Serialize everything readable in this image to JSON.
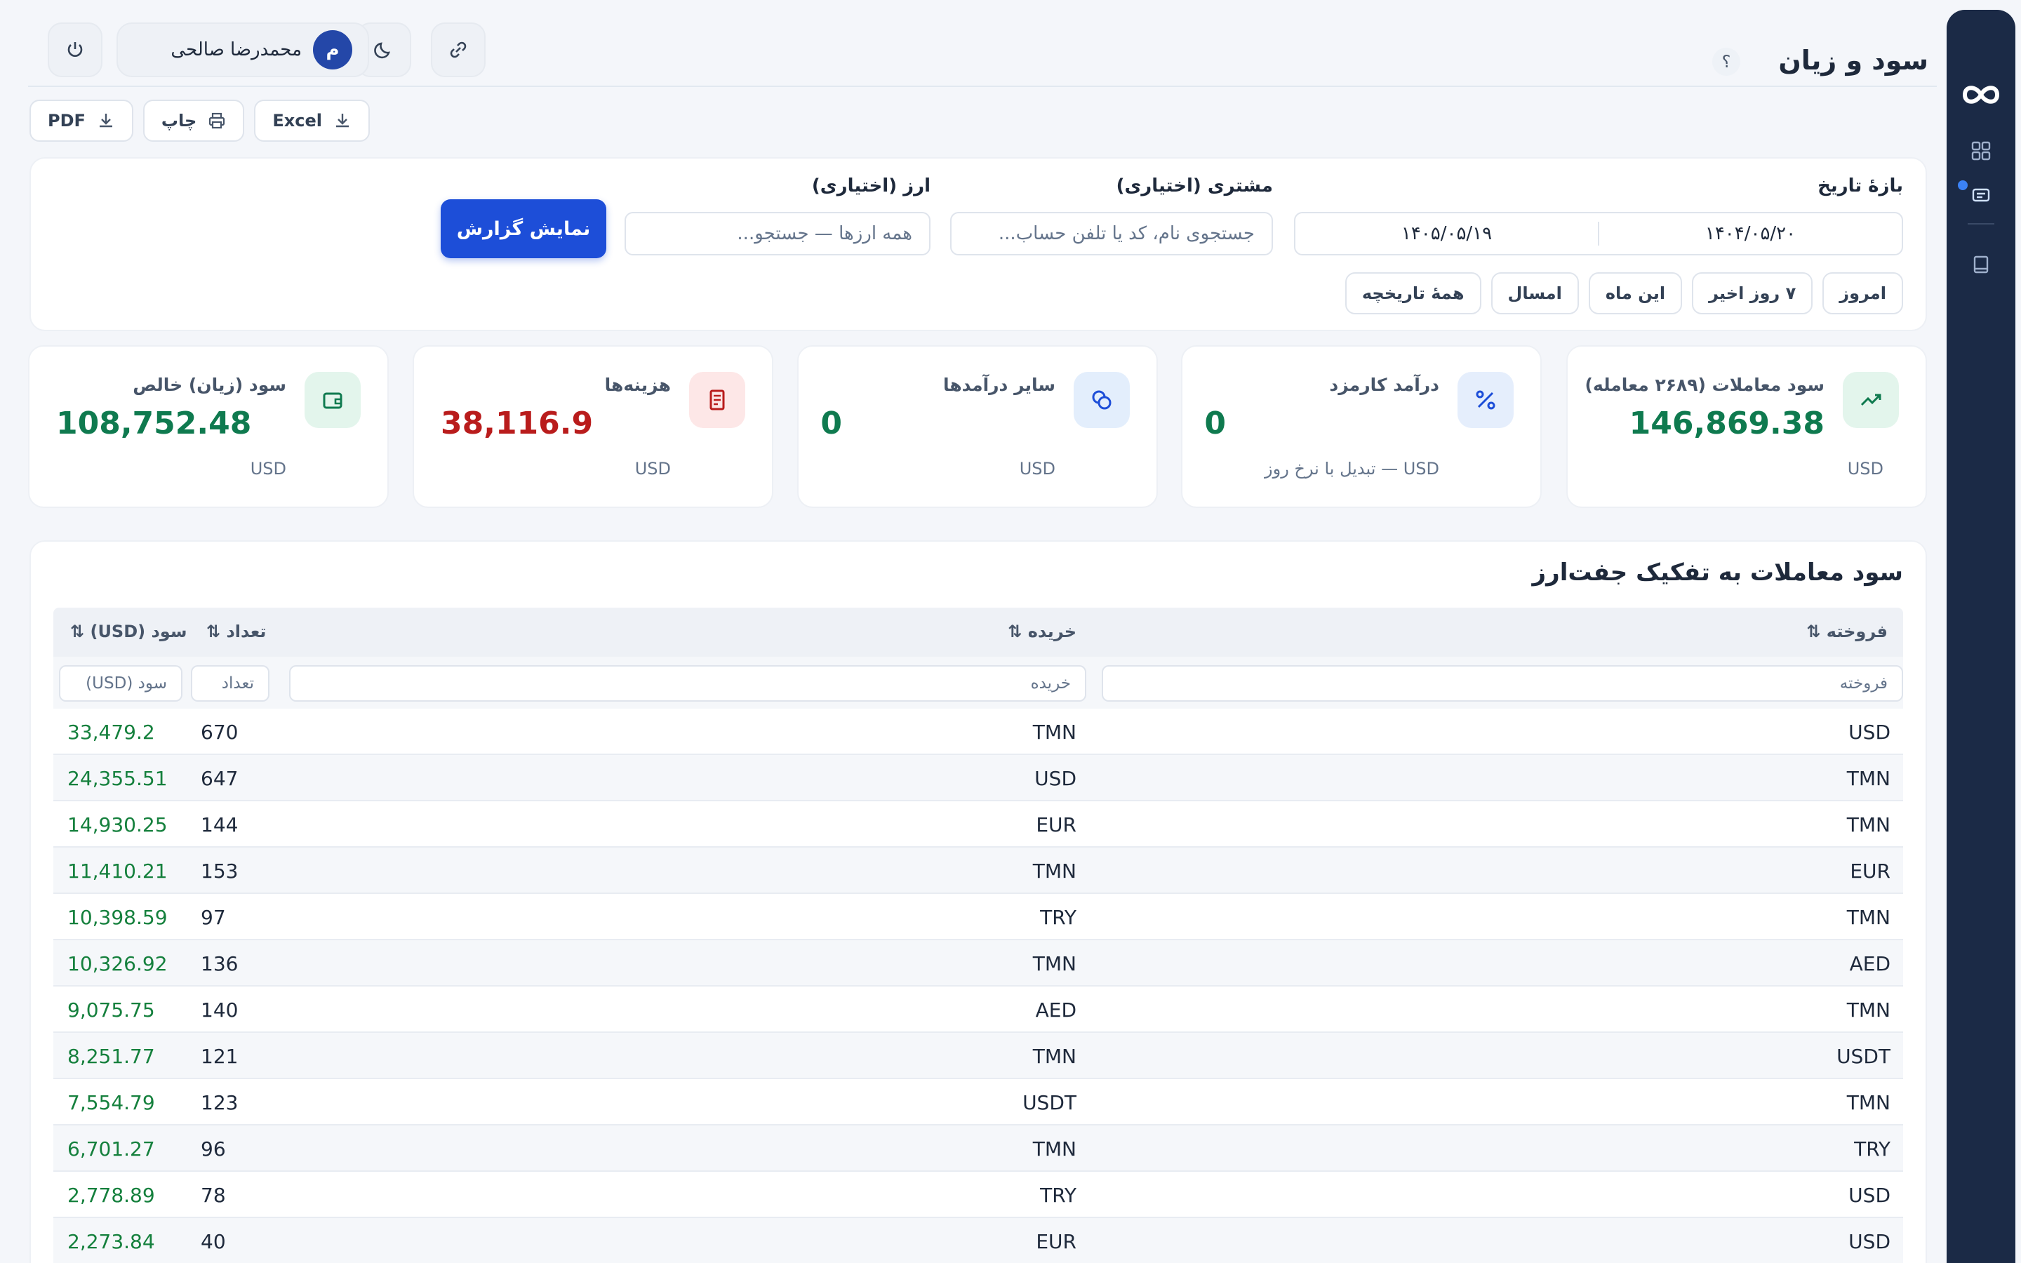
{
  "header": {
    "title": "سود و زیان",
    "help": "؟",
    "user_name": "محمدرضا صالحی",
    "user_initial": "م"
  },
  "export": {
    "excel": "Excel",
    "print": "چاپ",
    "pdf": "PDF"
  },
  "filters": {
    "date_label": "بازهٔ تاریخ",
    "date_from": "۱۴۰۴/۰۵/۲۰",
    "date_to": "۱۴۰۵/۰۵/۱۹",
    "customer_label": "مشتری (اختیاری)",
    "customer_placeholder": "جستجوی نام، کد یا تلفن حساب...",
    "currency_label": "ارز (اختیاری)",
    "currency_placeholder": "همه ارزها — جستجو...",
    "submit": "نمایش گزارش",
    "chips": [
      "امروز",
      "۷ روز اخیر",
      "این ماه",
      "امسال",
      "همهٔ تاریخچه"
    ]
  },
  "stats": [
    {
      "label": "سود معاملات (۲۶۸۹ معامله)",
      "value": "146,869.38",
      "unit": "USD",
      "color": "#0f7a4f",
      "icon": "trending-up-icon"
    },
    {
      "label": "درآمد کارمزد",
      "value": "0",
      "unit": "USD — تبدیل با نرخ روز",
      "color": "#0f7a4f",
      "icon": "percent-icon"
    },
    {
      "label": "سایر درآمدها",
      "value": "0",
      "unit": "USD",
      "color": "#0f7a4f",
      "icon": "coins-icon"
    },
    {
      "label": "هزینه‌ها",
      "value": "38,116.9",
      "unit": "USD",
      "color": "#b91c1c",
      "icon": "receipt-icon"
    },
    {
      "label": "سود (زیان) خالص",
      "value": "108,752.48",
      "unit": "USD",
      "color": "#0f7a4f",
      "icon": "wallet-icon"
    }
  ],
  "table": {
    "title": "سود معاملات به تفکیک جفت‌ارز",
    "headers": {
      "sold": "فروخته ⇅",
      "bought": "خریده ⇅",
      "count": "تعداد ⇅",
      "profit": "سود (USD) ⇅"
    },
    "filter_placeholders": {
      "sold": "فروخته",
      "bought": "خریده",
      "count": "تعداد",
      "profit": "سود (USD)"
    },
    "rows": [
      {
        "sold": "USD",
        "bought": "TMN",
        "count": "670",
        "profit": "33,479.2"
      },
      {
        "sold": "TMN",
        "bought": "USD",
        "count": "647",
        "profit": "24,355.51"
      },
      {
        "sold": "TMN",
        "bought": "EUR",
        "count": "144",
        "profit": "14,930.25"
      },
      {
        "sold": "EUR",
        "bought": "TMN",
        "count": "153",
        "profit": "11,410.21"
      },
      {
        "sold": "TMN",
        "bought": "TRY",
        "count": "97",
        "profit": "10,398.59"
      },
      {
        "sold": "AED",
        "bought": "TMN",
        "count": "136",
        "profit": "10,326.92"
      },
      {
        "sold": "TMN",
        "bought": "AED",
        "count": "140",
        "profit": "9,075.75"
      },
      {
        "sold": "USDT",
        "bought": "TMN",
        "count": "121",
        "profit": "8,251.77"
      },
      {
        "sold": "TMN",
        "bought": "USDT",
        "count": "123",
        "profit": "7,554.79"
      },
      {
        "sold": "TRY",
        "bought": "TMN",
        "count": "96",
        "profit": "6,701.27"
      },
      {
        "sold": "USD",
        "bought": "TRY",
        "count": "78",
        "profit": "2,778.89"
      },
      {
        "sold": "USD",
        "bought": "EUR",
        "count": "40",
        "profit": "2,273.84"
      }
    ]
  }
}
